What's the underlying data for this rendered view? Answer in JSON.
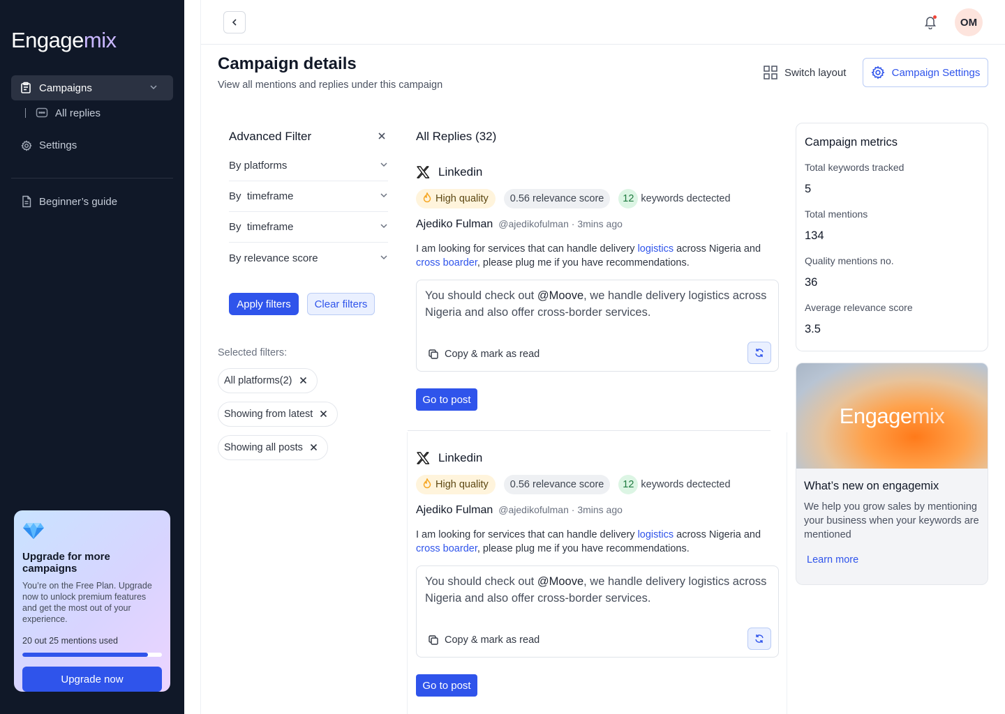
{
  "sidebar": {
    "logo_a": "Engage",
    "logo_b": "mix",
    "items": {
      "campaigns": "Campaigns",
      "all_replies": "All replies",
      "settings": "Settings",
      "guide": "Beginner’s guide"
    },
    "upgrade": {
      "title": "Upgrade for more campaigns",
      "text": "You’re on the Free Plan. Upgrade now to unlock premium features and get the most out of your experience.",
      "usage": "20 out 25 mentions used",
      "usage_fraction": 0.9,
      "button": "Upgrade now"
    }
  },
  "header": {
    "avatar": "OM",
    "title": "Campaign details",
    "subtitle": "View all mentions and replies under this campaign",
    "switch_layout": "Switch layout",
    "campaign_settings": "Campaign Settings"
  },
  "filters": {
    "title": "Advanced Filter",
    "rows": [
      "By platforms",
      "By  timeframe",
      "By  timeframe",
      "By relevance score"
    ],
    "apply": "Apply filters",
    "clear": "Clear filters",
    "selected_label": "Selected filters:",
    "chips": [
      "All platforms(2)",
      "Showing from latest",
      "Showing all posts"
    ]
  },
  "replies": {
    "title": "All Replies (32)",
    "items": [
      {
        "platform": "Linkedin",
        "quality": "High quality",
        "relevance": "0.56 relevance score",
        "keywords_count": "12",
        "keywords_label": "keywords dectected",
        "author": "Ajediko Fulman",
        "handle": "@ajedikofulman · 3mins ago",
        "text_a": "I am looking for services that can handle delivery ",
        "link_a": "logistics",
        "text_b": " across Nigeria and ",
        "link_b": "cross boarder",
        "text_c": ", please plug me if you have recommendations.",
        "reply_a": "You should check out ",
        "reply_mention": "@Moove",
        "reply_b": ", we handle delivery logistics across Nigeria and also offer cross-border services.",
        "copy": "Copy & mark as read",
        "go": "Go to post"
      },
      {
        "platform": "Linkedin",
        "quality": "High quality",
        "relevance": "0.56 relevance score",
        "keywords_count": "12",
        "keywords_label": "keywords dectected",
        "author": "Ajediko Fulman",
        "handle": "@ajedikofulman · 3mins ago",
        "text_a": "I am looking for services that can handle delivery ",
        "link_a": "logistics",
        "text_b": " across Nigeria and ",
        "link_b": "cross boarder",
        "text_c": ", please plug me if you have recommendations.",
        "reply_a": "You should check out ",
        "reply_mention": "@Moove",
        "reply_b": ", we handle delivery logistics across Nigeria and also offer cross-border services.",
        "copy": "Copy & mark as read",
        "go": "Go to post"
      }
    ]
  },
  "metrics": {
    "title": "Campaign metrics",
    "items": [
      {
        "label": "Total keywords tracked",
        "value": "5"
      },
      {
        "label": "Total mentions",
        "value": "134"
      },
      {
        "label": "Quality mentions no.",
        "value": "36"
      },
      {
        "label": "Average relevance score",
        "value": "3.5"
      }
    ]
  },
  "whats_new": {
    "banner_a": "Engage",
    "banner_b": "mix",
    "title": "What’s new on engagemix",
    "text": "We help you grow sales by mentioning your business when your keywords are mentioned",
    "link": "Learn more"
  }
}
